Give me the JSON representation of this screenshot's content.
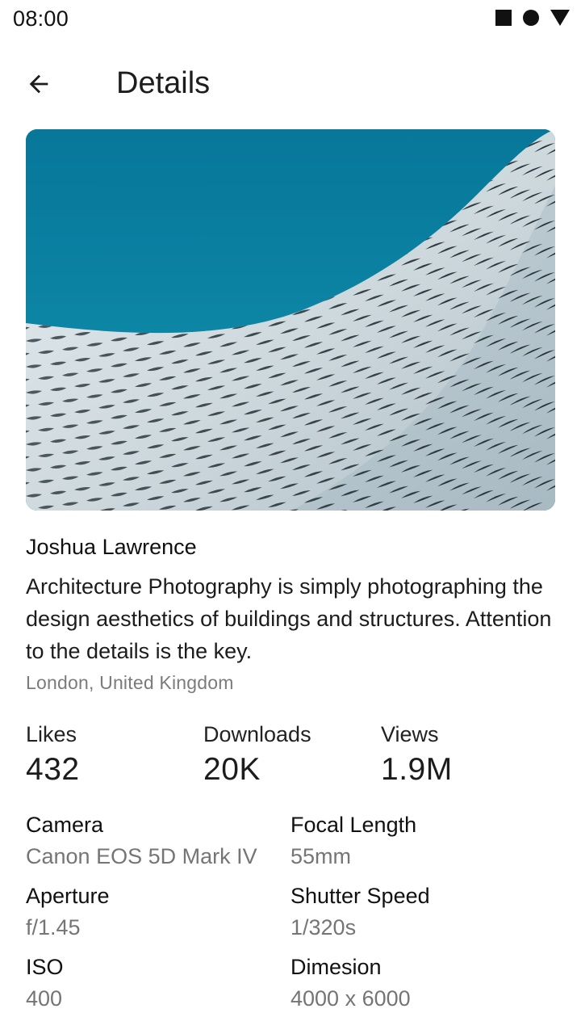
{
  "status_bar": {
    "time": "08:00"
  },
  "app_bar": {
    "title": "Details"
  },
  "photo": {
    "alt": "Architecture photograph: woven aluminium facade against a teal sky"
  },
  "author": "Joshua Lawrence",
  "description": "Architecture Photography is simply photographing the design aesthetics of buildings and structures. Attention to the details is the key.",
  "location": "London, United Kingdom",
  "stats": [
    {
      "label": "Likes",
      "value": "432"
    },
    {
      "label": "Downloads",
      "value": "20K"
    },
    {
      "label": "Views",
      "value": "1.9M"
    }
  ],
  "exif": [
    {
      "label": "Camera",
      "value": "Canon EOS 5D Mark IV"
    },
    {
      "label": "Focal Length",
      "value": "55mm"
    },
    {
      "label": "Aperture",
      "value": "f/1.45"
    },
    {
      "label": "Shutter Speed",
      "value": "1/320s"
    },
    {
      "label": "ISO",
      "value": "400"
    },
    {
      "label": "Dimesion",
      "value": "4000 x 6000"
    }
  ],
  "colors": {
    "sky": "#087d9a",
    "facade": "#d3dde2",
    "text_secondary": "#757575"
  }
}
